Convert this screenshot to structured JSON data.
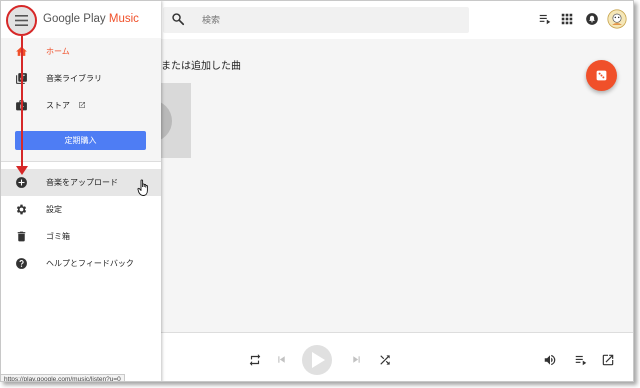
{
  "app": {
    "brand_prefix": "Google Play ",
    "brand_accent": "Music",
    "accent_color": "#f0502a"
  },
  "search": {
    "placeholder": "検索",
    "icon": "search-icon"
  },
  "topbar_icons": [
    "queue-icon",
    "apps-grid-icon",
    "notifications-icon",
    "avatar"
  ],
  "drawer": {
    "items": [
      {
        "label": "ホーム",
        "icon": "home-icon",
        "active": true
      },
      {
        "label": "音楽ライブラリ",
        "icon": "library-icon",
        "active": false
      },
      {
        "label": "ストア",
        "icon": "store-icon",
        "active": false,
        "external": true
      }
    ],
    "subscribe_label": "定期購入",
    "secondary_items": [
      {
        "label": "音楽をアップロード",
        "icon": "upload-icon",
        "hovered": true
      },
      {
        "label": "設定",
        "icon": "gear-icon"
      },
      {
        "label": "ゴミ箱",
        "icon": "trash-icon"
      },
      {
        "label": "ヘルプとフィードバック",
        "icon": "help-icon"
      }
    ]
  },
  "main": {
    "section_title": "または追加した曲"
  },
  "player": {
    "controls": [
      "repeat-icon",
      "previous-icon",
      "play-icon",
      "next-icon",
      "shuffle-icon"
    ],
    "right_controls": [
      "volume-icon",
      "queue-icon",
      "expand-icon"
    ]
  },
  "status_bar": {
    "url": "https://play.google.com/music/listen?u=0"
  }
}
